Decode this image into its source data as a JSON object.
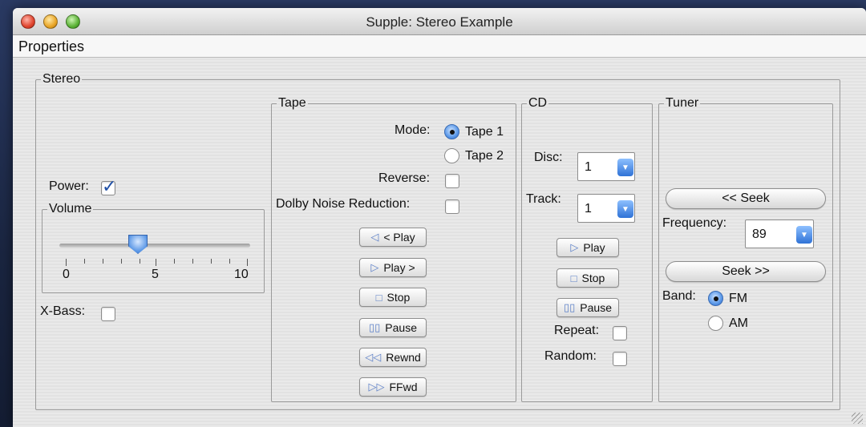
{
  "window": {
    "title": "Supple: Stereo Example"
  },
  "menubar": {
    "items": [
      "Properties"
    ]
  },
  "stereo": {
    "legend": "Stereo",
    "power_label": "Power:",
    "power_checked": true,
    "volume": {
      "legend": "Volume",
      "min_label": "0",
      "mid_label": "5",
      "max_label": "10",
      "value": 4
    },
    "xbass_label": "X-Bass:",
    "xbass_checked": false
  },
  "tape": {
    "legend": "Tape",
    "mode_label": "Mode:",
    "mode_options": [
      "Tape 1",
      "Tape 2"
    ],
    "mode_selected": "Tape 1",
    "reverse_label": "Reverse:",
    "dolby_label": "Dolby Noise Reduction:",
    "buttons": [
      {
        "label": "< Play",
        "icon": "◁"
      },
      {
        "label": "Play >",
        "icon": "▷"
      },
      {
        "label": "Stop",
        "icon": "□"
      },
      {
        "label": "Pause",
        "icon": "▯▯"
      },
      {
        "label": "Rewnd",
        "icon": "◁◁"
      },
      {
        "label": "FFwd",
        "icon": "▷▷"
      }
    ]
  },
  "cd": {
    "legend": "CD",
    "disc_label": "Disc:",
    "disc_value": "1",
    "track_label": "Track:",
    "track_value": "1",
    "buttons": [
      {
        "label": "Play",
        "icon": "▷"
      },
      {
        "label": "Stop",
        "icon": "□"
      },
      {
        "label": "Pause",
        "icon": "▯▯"
      }
    ],
    "repeat_label": "Repeat:",
    "random_label": "Random:"
  },
  "tuner": {
    "legend": "Tuner",
    "seek_back_label": "<< Seek",
    "frequency_label": "Frequency:",
    "frequency_value": "89",
    "seek_forward_label": "Seek >>",
    "band_label": "Band:",
    "band_options": [
      "FM",
      "AM"
    ],
    "band_selected": "FM"
  },
  "colors": {
    "accent": "#3b78d8",
    "window_bg": "#e6e6e6",
    "desktop_bg": "#1b2740"
  }
}
